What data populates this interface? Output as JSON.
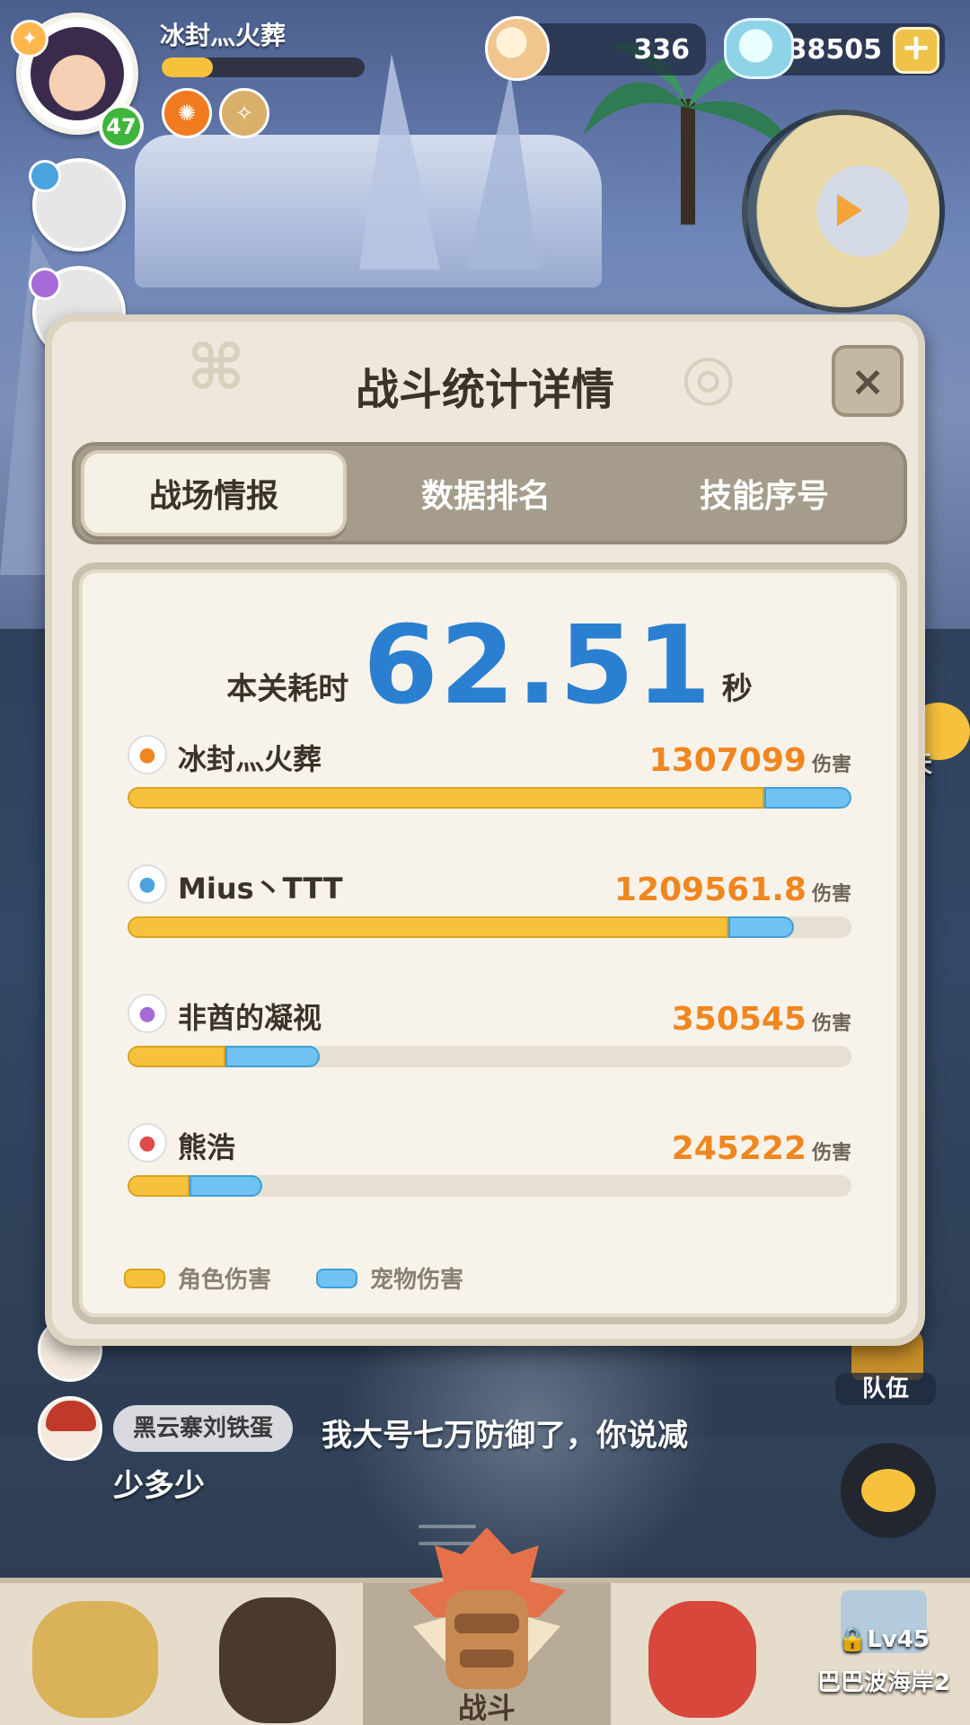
{
  "hud": {
    "player_name": "冰封灬火葬",
    "level": "47",
    "xp_fraction": 0.25,
    "shells": "336",
    "pearls": "38505",
    "plus_label": "+"
  },
  "modal": {
    "title": "战斗统计详情",
    "close_label": "×",
    "tabs": [
      "战场情报",
      "数据排名",
      "技能序号"
    ],
    "time_label": "本关耗时",
    "time_value": "62.51",
    "time_unit": "秒",
    "damage_unit": "伤害",
    "players": [
      {
        "name": "冰封灬火葬",
        "damage": "1307099",
        "role_fraction": 0.88,
        "pet_fraction": 0.12,
        "icon": "orange-class-icon",
        "color": "#f0861f"
      },
      {
        "name": "Mius丶TTT",
        "damage": "1209561.8",
        "role_fraction": 0.83,
        "pet_fraction": 0.09,
        "icon": "blue-class-icon",
        "color": "#4aa3df"
      },
      {
        "name": "非酋的凝视",
        "damage": "350545",
        "role_fraction": 0.135,
        "pet_fraction": 0.13,
        "icon": "purple-class-icon",
        "color": "#a66bd6"
      },
      {
        "name": "熊浩",
        "damage": "245222",
        "role_fraction": 0.085,
        "pet_fraction": 0.1,
        "icon": "red-class-icon",
        "color": "#e04a4a"
      }
    ],
    "legend": {
      "role": "角色伤害",
      "pet": "宠物伤害"
    }
  },
  "side": {
    "chat_label": "聊天",
    "team_label": "队伍"
  },
  "chat": {
    "name": "黑云寨刘铁蛋",
    "message_line1": "我大号七万防御了，你说减",
    "message_line2": "少多少"
  },
  "nav": {
    "battle_label": "战斗",
    "lock_level": "Lv45",
    "lock_map": "巴巴波海岸2"
  }
}
